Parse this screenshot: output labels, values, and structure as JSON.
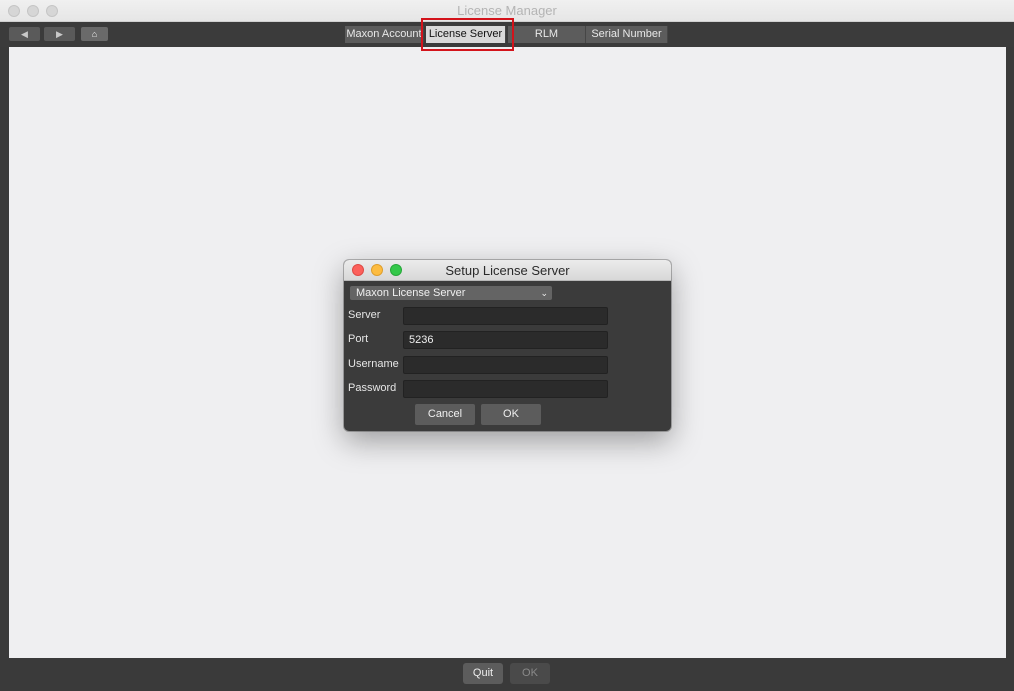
{
  "window": {
    "title": "License Manager",
    "nav": {
      "back_icon": "◀",
      "forward_icon": "▶",
      "home_icon": "⌂"
    }
  },
  "tabs": [
    {
      "label": "Maxon Account"
    },
    {
      "label": "License Server",
      "active": true
    },
    {
      "label": "RLM"
    },
    {
      "label": "Serial Number"
    }
  ],
  "highlight_color": "#d3131b",
  "dialog": {
    "title": "Setup License Server",
    "server_type": "Maxon License Server",
    "fields": {
      "server": {
        "label": "Server",
        "value": ""
      },
      "port": {
        "label": "Port",
        "value": "5236"
      },
      "username": {
        "label": "Username",
        "value": ""
      },
      "password": {
        "label": "Password",
        "value": ""
      }
    },
    "cancel_label": "Cancel",
    "ok_label": "OK"
  },
  "footer": {
    "quit_label": "Quit",
    "ok_label": "OK"
  }
}
